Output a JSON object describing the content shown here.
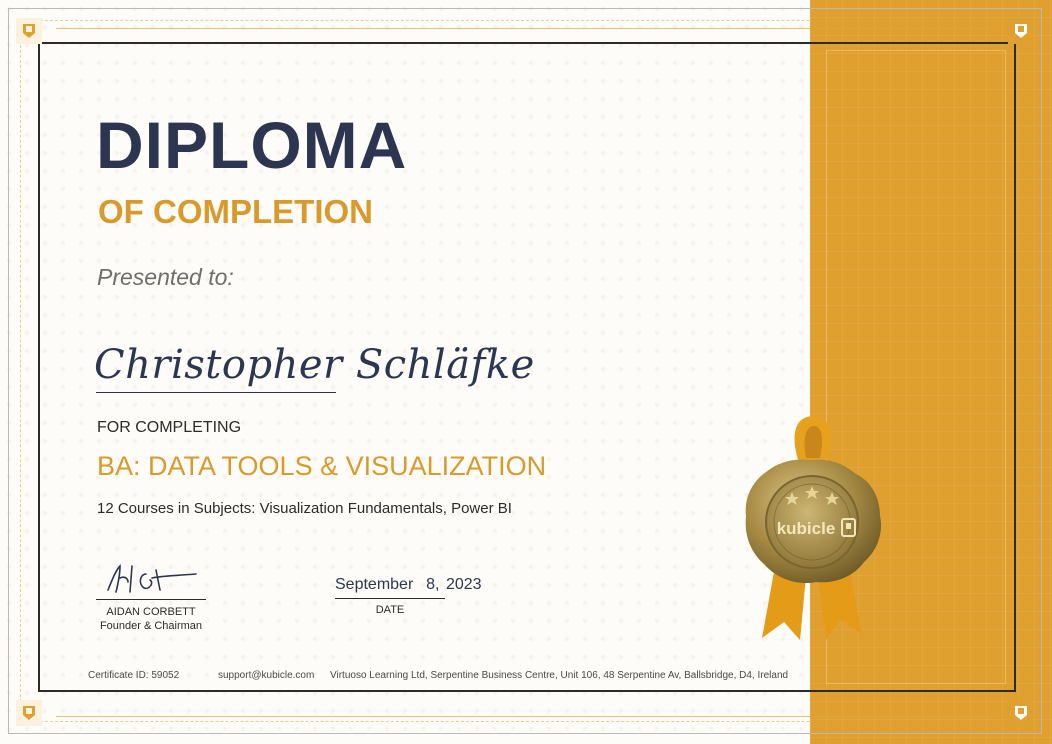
{
  "certificate": {
    "title": "DIPLOMA",
    "subtitle": "OF COMPLETION",
    "presented_label": "Presented to:",
    "recipient_name": "Christopher Schläfke",
    "for_label": "FOR COMPLETING",
    "course_title": "BA: DATA TOOLS & VISUALIZATION",
    "course_detail": "12 Courses in Subjects: Visualization Fundamentals, Power BI"
  },
  "signatory": {
    "name": "AIDAN CORBETT",
    "role": "Founder & Chairman"
  },
  "date": {
    "value": "September  8, 2023",
    "label": "DATE"
  },
  "footer": {
    "certificate_id": "Certificate ID: 59052",
    "email": "support@kubicle.com",
    "address": "Virtuoso Learning Ltd, Serpentine Business Centre, Unit 106, 48 Serpentine Av, Ballsbridge, D4, Ireland"
  },
  "seal": {
    "brand": "kubicle"
  },
  "icons": {
    "corner": "kubicle-shield-icon",
    "seal": "wax-seal-icon",
    "signature": "signature-icon"
  },
  "colors": {
    "navy": "#2c3651",
    "gold": "#d99a2c",
    "band": "#e0a030",
    "seal": "#b49a52"
  }
}
